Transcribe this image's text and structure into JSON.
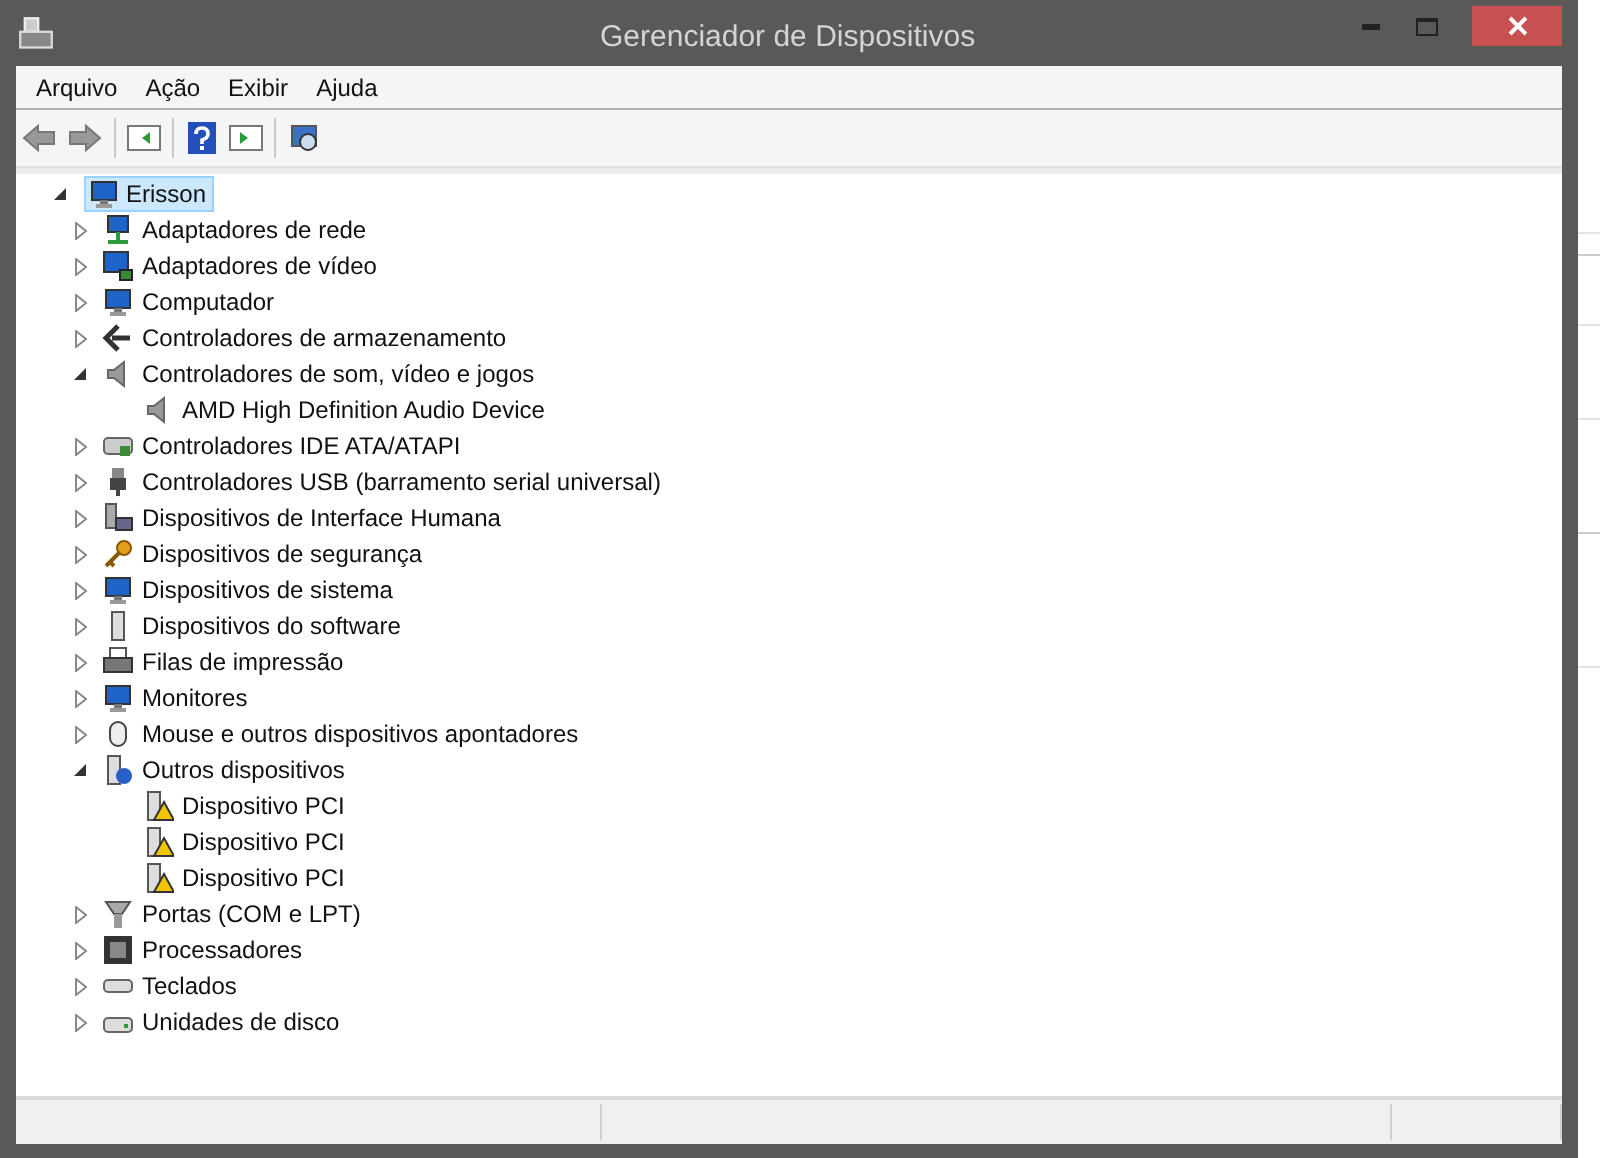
{
  "window": {
    "title": "Gerenciador de Dispositivos"
  },
  "menu": [
    "Arquivo",
    "Ação",
    "Exibir",
    "Ajuda"
  ],
  "tree": {
    "label": "Erisson",
    "expanded": true,
    "selected": true,
    "children": [
      {
        "label": "Adaptadores de rede",
        "expanded": false
      },
      {
        "label": "Adaptadores de vídeo",
        "expanded": false
      },
      {
        "label": "Computador",
        "expanded": false
      },
      {
        "label": "Controladores de armazenamento",
        "expanded": false
      },
      {
        "label": "Controladores de som, vídeo e jogos",
        "expanded": true,
        "children": [
          {
            "label": "AMD High Definition Audio Device"
          }
        ]
      },
      {
        "label": "Controladores IDE ATA/ATAPI",
        "expanded": false
      },
      {
        "label": "Controladores USB (barramento serial universal)",
        "expanded": false
      },
      {
        "label": "Dispositivos de Interface Humana",
        "expanded": false
      },
      {
        "label": "Dispositivos de segurança",
        "expanded": false
      },
      {
        "label": "Dispositivos de sistema",
        "expanded": false
      },
      {
        "label": "Dispositivos do software",
        "expanded": false
      },
      {
        "label": "Filas de impressão",
        "expanded": false
      },
      {
        "label": "Monitores",
        "expanded": false
      },
      {
        "label": "Mouse e outros dispositivos apontadores",
        "expanded": false
      },
      {
        "label": "Outros dispositivos",
        "expanded": true,
        "children": [
          {
            "label": "Dispositivo PCI"
          },
          {
            "label": "Dispositivo PCI"
          },
          {
            "label": "Dispositivo PCI"
          }
        ]
      },
      {
        "label": "Portas (COM e LPT)",
        "expanded": false
      },
      {
        "label": "Processadores",
        "expanded": false
      },
      {
        "label": "Teclados",
        "expanded": false
      },
      {
        "label": "Unidades de disco",
        "expanded": false
      }
    ]
  }
}
